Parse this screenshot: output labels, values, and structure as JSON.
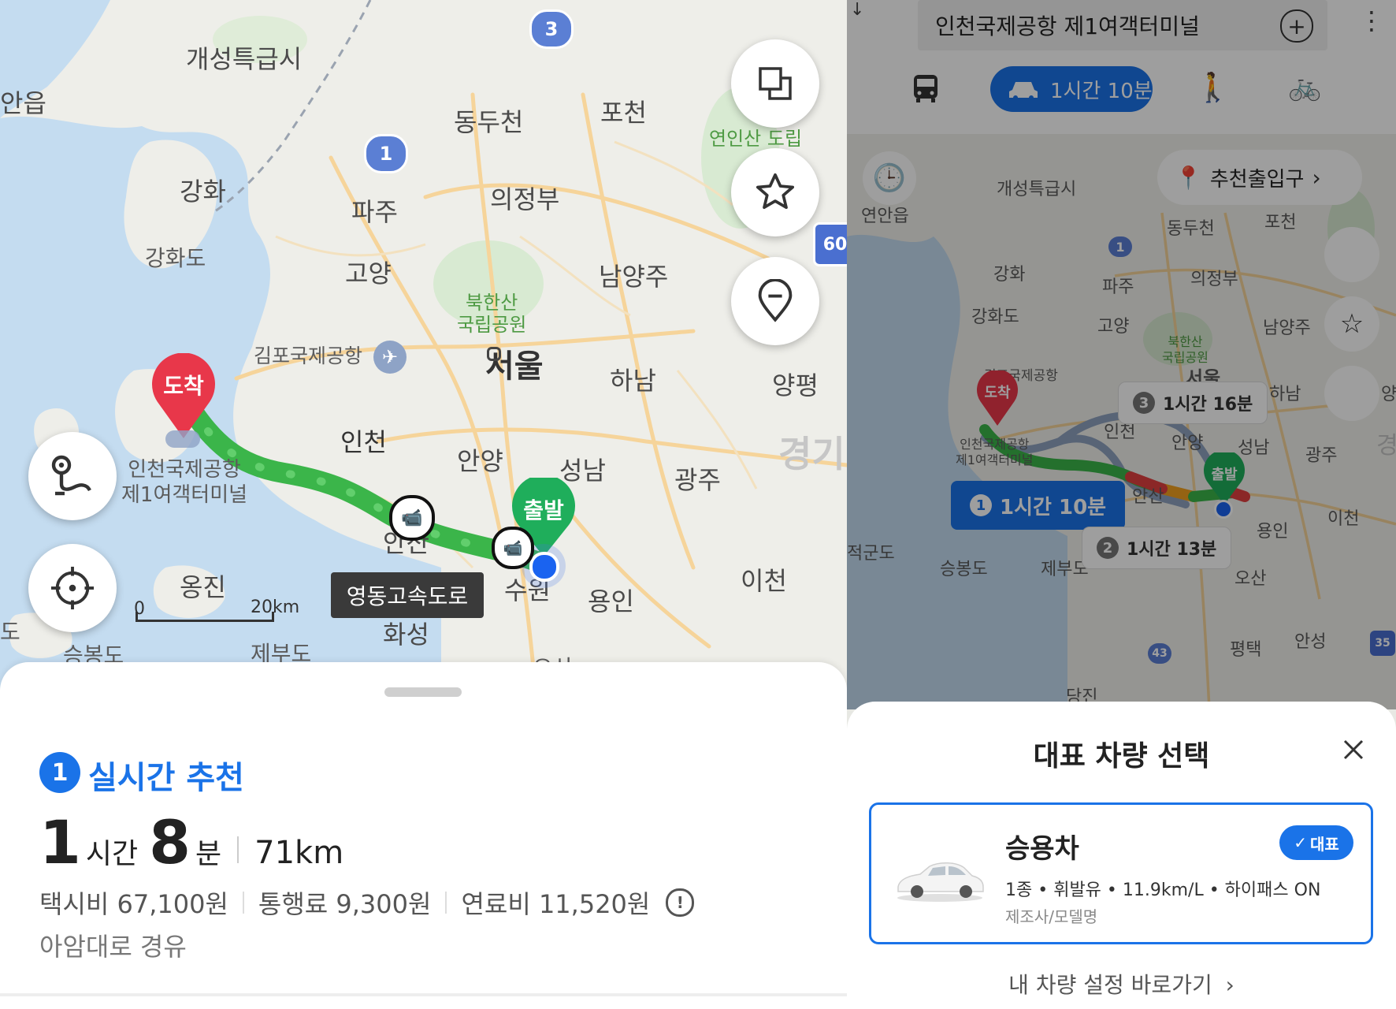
{
  "left": {
    "map_labels": {
      "kaeseong": "개성특급시",
      "anup": "안읍",
      "dongducheon": "동두천",
      "pocheon": "포천",
      "ganghwa": "강화",
      "paju": "파주",
      "uijeongbu": "의정부",
      "ganghwado": "강화도",
      "goyang": "고양",
      "namyangju": "남양주",
      "bukhansan": "북한산\n국립공원",
      "yeoninsan": "연인산\n도립",
      "gimpo_airport": "김포국제공항",
      "seoul": "서울",
      "hanam": "하남",
      "yangpyeong": "양평",
      "incheon": "인천",
      "anyang": "안양",
      "seongnam": "성남",
      "gwangju": "광주",
      "gyeong": "경기",
      "incheon_airport": "인천국제공항\n제1여객터미널",
      "ansan": "안산",
      "ongjin": "옹진",
      "suwon": "수원",
      "yongin": "용인",
      "icheon": "이천",
      "hwaseong": "화성",
      "seungbongdo": "승봉도",
      "jebudo": "제부도",
      "do": "도",
      "osan": "오산"
    },
    "road_badges": {
      "r3": "3",
      "r1": "1",
      "r60": "60"
    },
    "markers": {
      "arrive": "도착",
      "depart": "출발"
    },
    "road_tooltip": "영동고속도로",
    "scale": {
      "zero": "0",
      "dist": "20km"
    },
    "buttons": {
      "layer": "layers-icon",
      "favorite": "star-icon",
      "pin": "pin-icon",
      "route": "route-icon",
      "locate": "locate-icon"
    },
    "sheet": {
      "badge": "1",
      "title": "실시간 추천",
      "hours": "1",
      "hours_unit": "시간",
      "minutes": "8",
      "minutes_unit": "분",
      "distance": "71km",
      "taxi": "택시비 67,100원",
      "toll": "통행료 9,300원",
      "fuel": "연료비 11,520원",
      "via": "아암대로 경유"
    }
  },
  "right": {
    "destination": "인천국제공항 제1여객터미널",
    "mode_car_label": "1시간 10분",
    "entrance_button": "추천출입구",
    "map_labels": {
      "kaeseong": "개성특급시",
      "yeonanup": "연안읍",
      "dongducheon": "동두천",
      "pocheon": "포천",
      "ganghwa": "강화",
      "paju": "파주",
      "uijeongbu": "의정부",
      "ganghwado": "강화도",
      "goyang": "고양",
      "namyangju": "남양주",
      "bukhansan": "북한산\n국립공원",
      "gimpo": "김포국제공항",
      "seoul": "서울",
      "hanam": "하남",
      "yangp": "양평",
      "incheon": "인천",
      "anyang": "안양",
      "seongnam": "성남",
      "gwangju": "광주",
      "icheon": "이천",
      "airport": "인천국제공항\n제1여객터미널",
      "ansan": "안산",
      "yongin": "용인",
      "jeokgundo": "적군도",
      "seungbongdo": "승봉도",
      "jebudo": "제부도",
      "osan": "오산",
      "pyeongtaek": "평택",
      "anseong": "안성",
      "dangjin": "당진",
      "gyeong": "경"
    },
    "markers": {
      "arrive": "도착",
      "depart": "출발"
    },
    "routes": [
      {
        "num": "1",
        "label": "1시간 10분"
      },
      {
        "num": "2",
        "label": "1시간 13분"
      },
      {
        "num": "3",
        "label": "1시간 16분"
      }
    ],
    "badges": {
      "r1": "1",
      "r43": "43",
      "r35": "35"
    },
    "sheet": {
      "title": "대표 차량 선택",
      "vehicle_name": "승용차",
      "tag": "대표",
      "specs": "1종 • 휘발유 • 11.9km/L • 하이패스 ON",
      "maker": "제조사/모델명",
      "link": "내 차량 설정 바로가기"
    }
  },
  "colors": {
    "accent_blue": "#1a73e8",
    "route_green": "#3bb54a",
    "arrive_red": "#e8374a",
    "depart_green": "#1fae5b"
  }
}
